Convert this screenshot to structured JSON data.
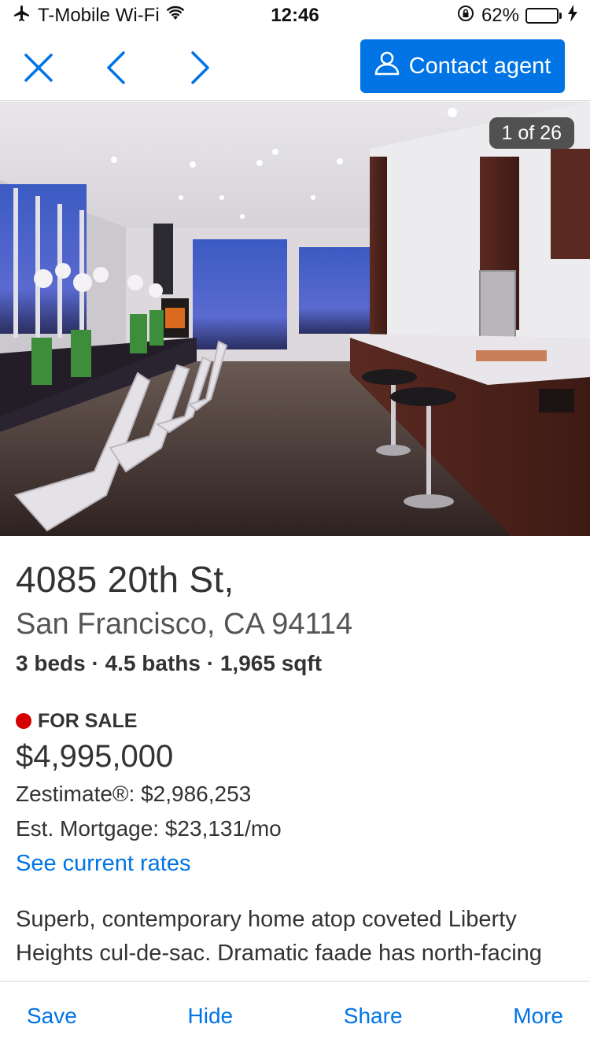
{
  "status_bar": {
    "carrier": "T-Mobile Wi-Fi",
    "time": "12:46",
    "battery_percent": "62%",
    "battery_level": 0.62
  },
  "nav": {
    "close_icon": "close-icon",
    "prev_icon": "chevron-left-icon",
    "next_icon": "chevron-right-icon",
    "contact_label": "Contact agent",
    "accent_color": "#0074e4"
  },
  "photo": {
    "counter": "1 of 26"
  },
  "listing": {
    "address_line1": "4085 20th St,",
    "address_line2": "San Francisco, CA 94114",
    "facts": "3 beds · 4.5 baths · 1,965 sqft",
    "status": "FOR SALE",
    "status_color": "#d40000",
    "price": "$4,995,000",
    "zestimate": "Zestimate®: $2,986,253",
    "mortgage": "Est. Mortgage: $23,131/mo",
    "rates_link": "See current rates",
    "description": "Superb, contemporary home atop coveted Liberty Heights cul-de-sac. Dramatic faade has north-facing windows with spectacular city views from"
  },
  "toolbar": {
    "save": "Save",
    "hide": "Hide",
    "share": "Share",
    "more": "More"
  }
}
